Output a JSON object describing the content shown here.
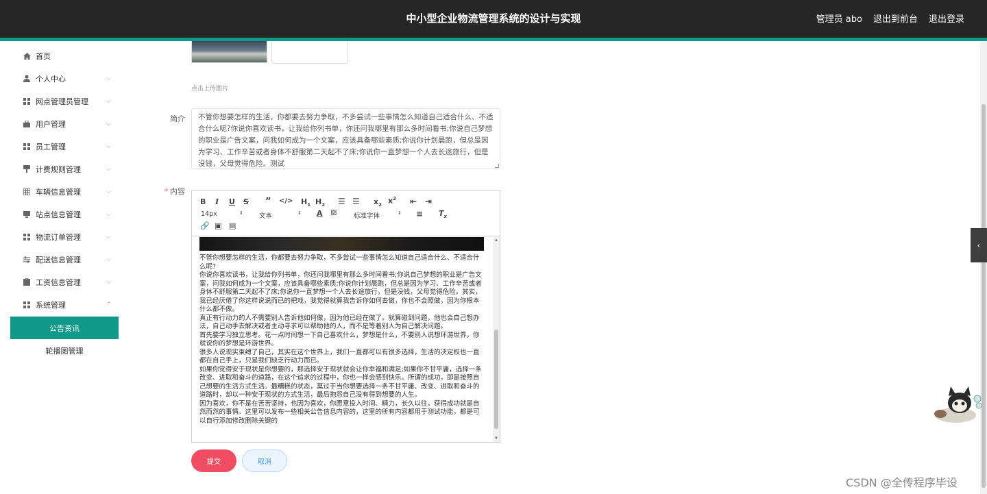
{
  "header": {
    "title": "中小型企业物流管理系统的设计与实现",
    "user_label": "管理员 abo",
    "back_front": "退出到前台",
    "logout": "退出登录"
  },
  "sidebar": {
    "items": [
      {
        "label": "首页",
        "icon": "home-icon"
      },
      {
        "label": "个人中心",
        "icon": "user-icon"
      },
      {
        "label": "网点管理员管理",
        "icon": "grid-icon"
      },
      {
        "label": "用户管理",
        "icon": "bag-icon"
      },
      {
        "label": "员工管理",
        "icon": "grid-icon"
      },
      {
        "label": "计费规则管理",
        "icon": "pin-icon"
      },
      {
        "label": "车辆信息管理",
        "icon": "table-icon"
      },
      {
        "label": "站点信息管理",
        "icon": "monitor-icon"
      },
      {
        "label": "物流订单管理",
        "icon": "grid-icon"
      },
      {
        "label": "配送信息管理",
        "icon": "sliders-icon"
      },
      {
        "label": "工资信息管理",
        "icon": "clipboard-icon"
      },
      {
        "label": "系统管理",
        "icon": "grid-icon"
      }
    ],
    "sub_items": [
      {
        "label": "公告资讯",
        "active": true
      },
      {
        "label": "轮播图管理",
        "active": false
      }
    ]
  },
  "form": {
    "upload_hint": "点击上传图片",
    "intro_label": "简介",
    "intro_value": "不管你想要怎样的生活，你都要去努力争取，不多尝试一些事情怎么知道自己适合什么、不适合什么呢?你说你喜欢读书，让我给你列书单，你还问我哪里有那么多时间看书;你说自己梦想的职业是广告文案，问我如何成为一个文案，应该具备哪些素质;你说你计划晨跑，但总是因为学习、工作辛苦或者身体不舒服第二天起不了床;你说你一直梦想一个人去长途旅行，但是没钱，父母觉得危险。测试",
    "content_label": "内容",
    "content_required": "*",
    "toolbar": {
      "font_size": "14px",
      "format": "文本",
      "font_family": "标准字体"
    },
    "content_paragraphs": [
      "不管你想要怎样的生活，你都要去努力争取，不多尝试一些事情怎么知道自己适合什么、不适合什么呢?",
      "你说你喜欢读书，让我给你列书单，你还问我哪里有那么多时间看书;你说自己梦想的职业是广告文案，问我如何成为一个文案，应该具备哪些素质;你说你计划晨跑，但总是因为学习、工作辛苦或者身体不舒服第二天起不了床;你说你一直梦想一个人去长途旅行，但是没钱，父母觉得危险。其实，我已经厌倦了你这样说说而已的把戏，我觉得就算我告诉你如何去做，你也不会照做，因为你根本什么都不做。",
      "真正有行动力的人不需要别人告诉他如何做，因为他已经在做了。就算碰到问题，他也会自己想办法，自己动手去解决或者主动寻求可以帮助他的人，而不是等着别人为自己解决问题。",
      "首先要学习独立思考。花一点时间想一下自己喜欢什么，梦想是什么，不要别人说想环游世界，你就说你的梦想是环游世界。",
      "很多人说现实束缚了自己，其实在这个世界上，我们一直都可以有很多选择，生活的决定权也一直都在自己手上，只是我们缺乏行动力而已。",
      "如果你觉得安于现状是你想要的，那选择安于现状就会让你幸福和满足;如果你不甘平庸，选择一条改变、进取和奋斗的道路，在这个追求的过程中，你也一样会感到快乐。所谓的成功，即是按照自己想要的生活方式生活。最糟糕的状态，莫过于当你想要选择一条不甘平庸、改变、进取和奋斗的道路时，却以一种安于现状的方式生活，最后抱怨自己没有得到想要的人生。",
      "因为喜欢，你不是在苦苦坚持，也因为喜欢，你愿意投入时间、精力，长久以往，获得成功就是自然而然的事情。这里可以发布一些相关公告信息内容的，这里的所有内容都用于测试功能，都是可以自行添加修改删除关键的"
    ],
    "submit_label": "提交",
    "cancel_label": "取消"
  },
  "watermark": "CSDN @全传程序毕设"
}
